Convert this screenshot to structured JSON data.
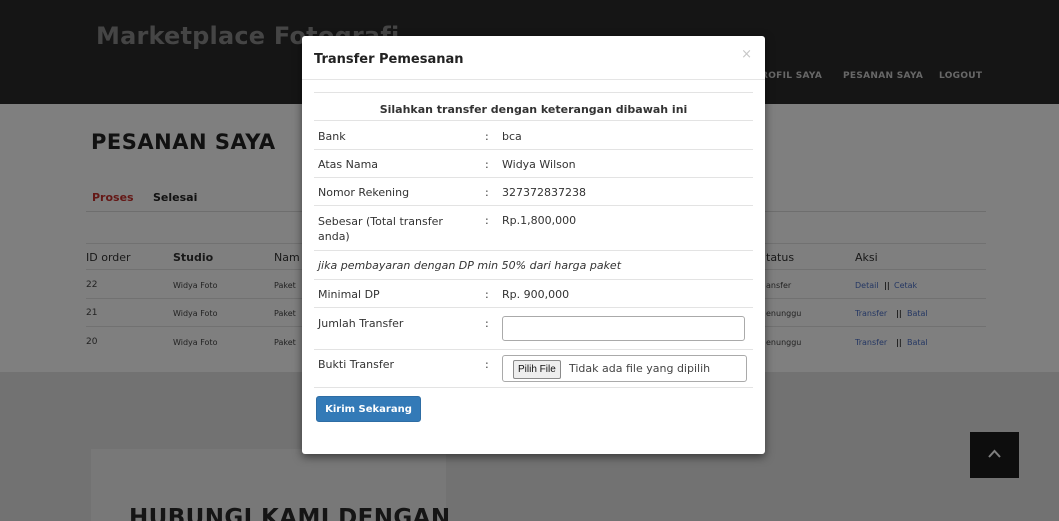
{
  "header": {
    "brand": "Marketplace Fotografi",
    "nav": [
      "ROFIL SAYA",
      "PESANAN SAYA",
      "LOGOUT"
    ]
  },
  "section": {
    "title": "PESANAN SAYA",
    "tabs": [
      {
        "label": "Proses",
        "active": true
      },
      {
        "label": "Selesai",
        "active": false
      }
    ]
  },
  "table": {
    "headers": [
      "ID order",
      "Studio",
      "Nam",
      "tatus",
      "Aksi"
    ],
    "rows": [
      {
        "id": "22",
        "studio": "Widya Foto",
        "nama": "Paket",
        "status": "ansfer",
        "aksi": [
          "Detail",
          "||",
          "Cetak"
        ]
      },
      {
        "id": "21",
        "studio": "Widya Foto",
        "nama": "Paket",
        "status": "enunggu",
        "aksi": [
          "Transfer",
          "||",
          "Batal"
        ]
      },
      {
        "id": "20",
        "studio": "Widya Foto",
        "nama": "Paket",
        "status": "enunggu",
        "aksi": [
          "Transfer",
          "||",
          "Batal"
        ]
      }
    ]
  },
  "contact": {
    "title": "HUBUNGI KAMI DENGAN"
  },
  "modal": {
    "title": "Transfer Pemesanan",
    "close": "×",
    "instruction": "Silahkan transfer dengan keterangan dibawah ini",
    "fields": [
      {
        "label": "Bank",
        "value": "bca"
      },
      {
        "label": "Atas Nama",
        "value": "Widya Wilson"
      },
      {
        "label": "Nomor Rekening",
        "value": "327372837238"
      },
      {
        "label": "Sebesar (Total transfer anda)",
        "value": "Rp.1,800,000"
      }
    ],
    "dp_note": "jika pembayaran dengan DP min 50% dari harga paket",
    "min_dp": {
      "label": "Minimal DP",
      "value": "Rp. 900,000"
    },
    "jumlah": {
      "label": "Jumlah Transfer",
      "value": ""
    },
    "bukti": {
      "label": "Bukti Transfer",
      "button": "Pilih File",
      "status": "Tidak ada file yang dipilih"
    },
    "colon": ":",
    "submit": "Kirim Sekarang"
  },
  "colors": {
    "header_bg": "#2b2b2b",
    "active_tab": "#c9302c",
    "link": "#4a6fc6",
    "primary_button": "#337ab7"
  },
  "icons": {
    "scroll_top": "chevron-up-icon",
    "close": "close-icon"
  }
}
